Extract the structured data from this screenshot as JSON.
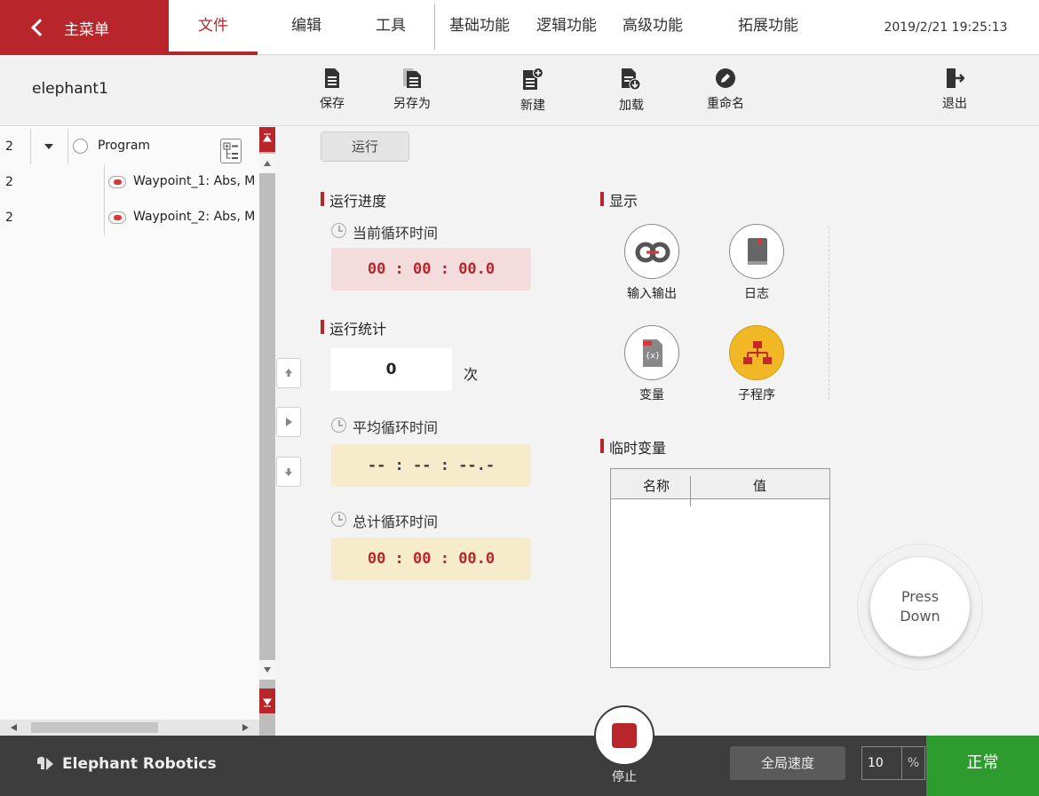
{
  "menu": {
    "main_menu": "主菜单",
    "tabs": [
      "文件",
      "编辑",
      "工具",
      "基础功能",
      "逻辑功能",
      "高级功能",
      "拓展功能"
    ],
    "datetime": "2019/2/21 19:25:13"
  },
  "toolbar": {
    "filename": "elephant1",
    "save": "保存",
    "save_as": "另存为",
    "new": "新建",
    "load": "加载",
    "rename": "重命名",
    "exit": "退出"
  },
  "tree": {
    "rows": [
      {
        "num": "2",
        "label": "Program"
      },
      {
        "num": "2",
        "label": "Waypoint_1: Abs, M"
      },
      {
        "num": "2",
        "label": "Waypoint_2: Abs, M"
      }
    ]
  },
  "run": {
    "tab_label": "运行",
    "progress_title": "运行进度",
    "current_cycle_label": "当前循环时间",
    "current_cycle_value": "00 : 00 : 00.0",
    "stats_title": "运行统计",
    "count_value": "0",
    "count_unit": "次",
    "avg_cycle_label": "平均循环时间",
    "avg_cycle_value": "-- : -- : --.-",
    "total_cycle_label": "总计循环时间",
    "total_cycle_value": "00 : 00 : 00.0"
  },
  "display": {
    "title": "显示",
    "io": "输入输出",
    "log": "日志",
    "variables": "变量",
    "subprogram": "子程序"
  },
  "temp_vars": {
    "title": "临时变量",
    "col_name": "名称",
    "col_value": "值"
  },
  "press_button": {
    "line1": "Press",
    "line2": "Down"
  },
  "footer": {
    "brand": "Elephant Robotics",
    "stop": "停止",
    "global_speed": "全局速度",
    "speed_value": "10",
    "speed_unit": "%",
    "status": "正常"
  },
  "colors": {
    "brand_red": "#b8262b",
    "status_green": "#2e9b2e",
    "subprogram_yellow": "#f1b724"
  }
}
